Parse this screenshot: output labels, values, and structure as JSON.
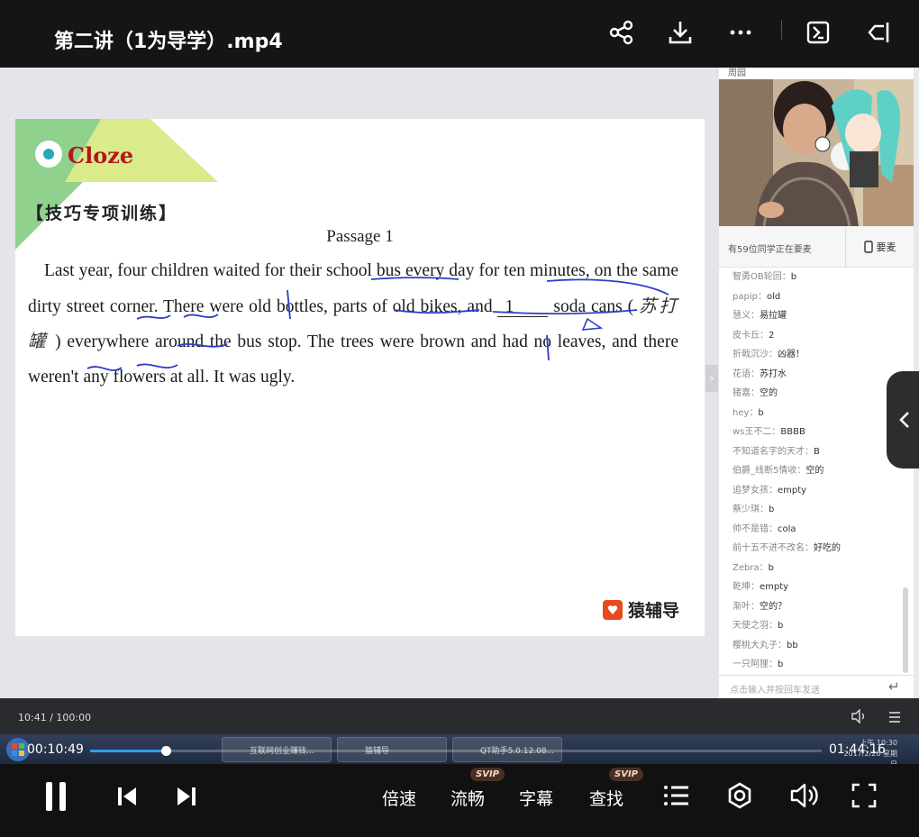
{
  "header": {
    "title": "第二讲（1为导学）.mp4",
    "icons": [
      "share-icon",
      "download-icon",
      "more-icon",
      "screenshot-icon",
      "float-window-icon"
    ]
  },
  "slide": {
    "section_title": "Cloze",
    "heading_cn": "【技巧专项训练】",
    "passage_title": "Passage 1",
    "p1": "Last year, four children waited for their school bus every day for ten minutes, on the same dirty street corner. There were old bottles, parts of old bikes, and",
    "blank_value": "1",
    "p2_a": "soda cans (",
    "handwritten_cn": "苏打罐",
    "p2_b": ") everywhere around the bus stop. The trees were brown and had no leaves, and there weren't any flowers at all. It was ugly.",
    "brand": "猿辅导",
    "accent_green": "#8fd18d",
    "accent_yellow": "#d9eb8a",
    "title_red": "#b4161b"
  },
  "side_panel": {
    "teacher_name": "周园",
    "mic_count_text": "有59位同学正在要麦",
    "mic_button": "要麦",
    "chat": [
      {
        "user": "智勇OB轮回：",
        "msg": "b"
      },
      {
        "user": "papip：",
        "msg": "old"
      },
      {
        "user": "慧义：",
        "msg": "易拉罐"
      },
      {
        "user": "皮卡丘：",
        "msg": "2"
      },
      {
        "user": "折戟沉沙：",
        "msg": "凶器！"
      },
      {
        "user": "花语：",
        "msg": "苏打水"
      },
      {
        "user": "猪嘉：",
        "msg": "空的"
      },
      {
        "user": "hey：",
        "msg": "b"
      },
      {
        "user": "ws王不二：",
        "msg": "BBBB"
      },
      {
        "user": "不知道名字的天才：",
        "msg": "B"
      },
      {
        "user": "伯爵_线断5情收：",
        "msg": "空的"
      },
      {
        "user": "追梦女孩：",
        "msg": "empty"
      },
      {
        "user": "蔡少琪：",
        "msg": "b"
      },
      {
        "user": "帅不是错：",
        "msg": "cola"
      },
      {
        "user": "前十五不进不改名：",
        "msg": "好吃的"
      },
      {
        "user": "Zebra：",
        "msg": "b"
      },
      {
        "user": "乾坤：",
        "msg": "empty"
      },
      {
        "user": "渐叶：",
        "msg": "空的？"
      },
      {
        "user": "天使之羽：",
        "msg": "b"
      },
      {
        "user": "樱桃大丸子：",
        "msg": "bb"
      },
      {
        "user": "一只阿狸：",
        "msg": "b"
      }
    ],
    "input_placeholder": "点击输入并按回车发送"
  },
  "inner_player": {
    "page_counter": "10:41 / 100:00"
  },
  "taskbar": {
    "tasks": [
      "互联网创业赚钱...",
      "猿辅导",
      "QT助手5.0.12.08..."
    ],
    "clock": "上午 10:30",
    "date": "2017/2/26 星期日"
  },
  "playback": {
    "current_time": "00:10:49",
    "total_time": "01:44:16",
    "progress": 0.104,
    "accent": "#2f9bf0"
  },
  "controls": {
    "speed_label": "倍速",
    "quality_label": "流畅",
    "subtitle_label": "字幕",
    "search_label": "查找",
    "svip_badge": "SVIP"
  }
}
